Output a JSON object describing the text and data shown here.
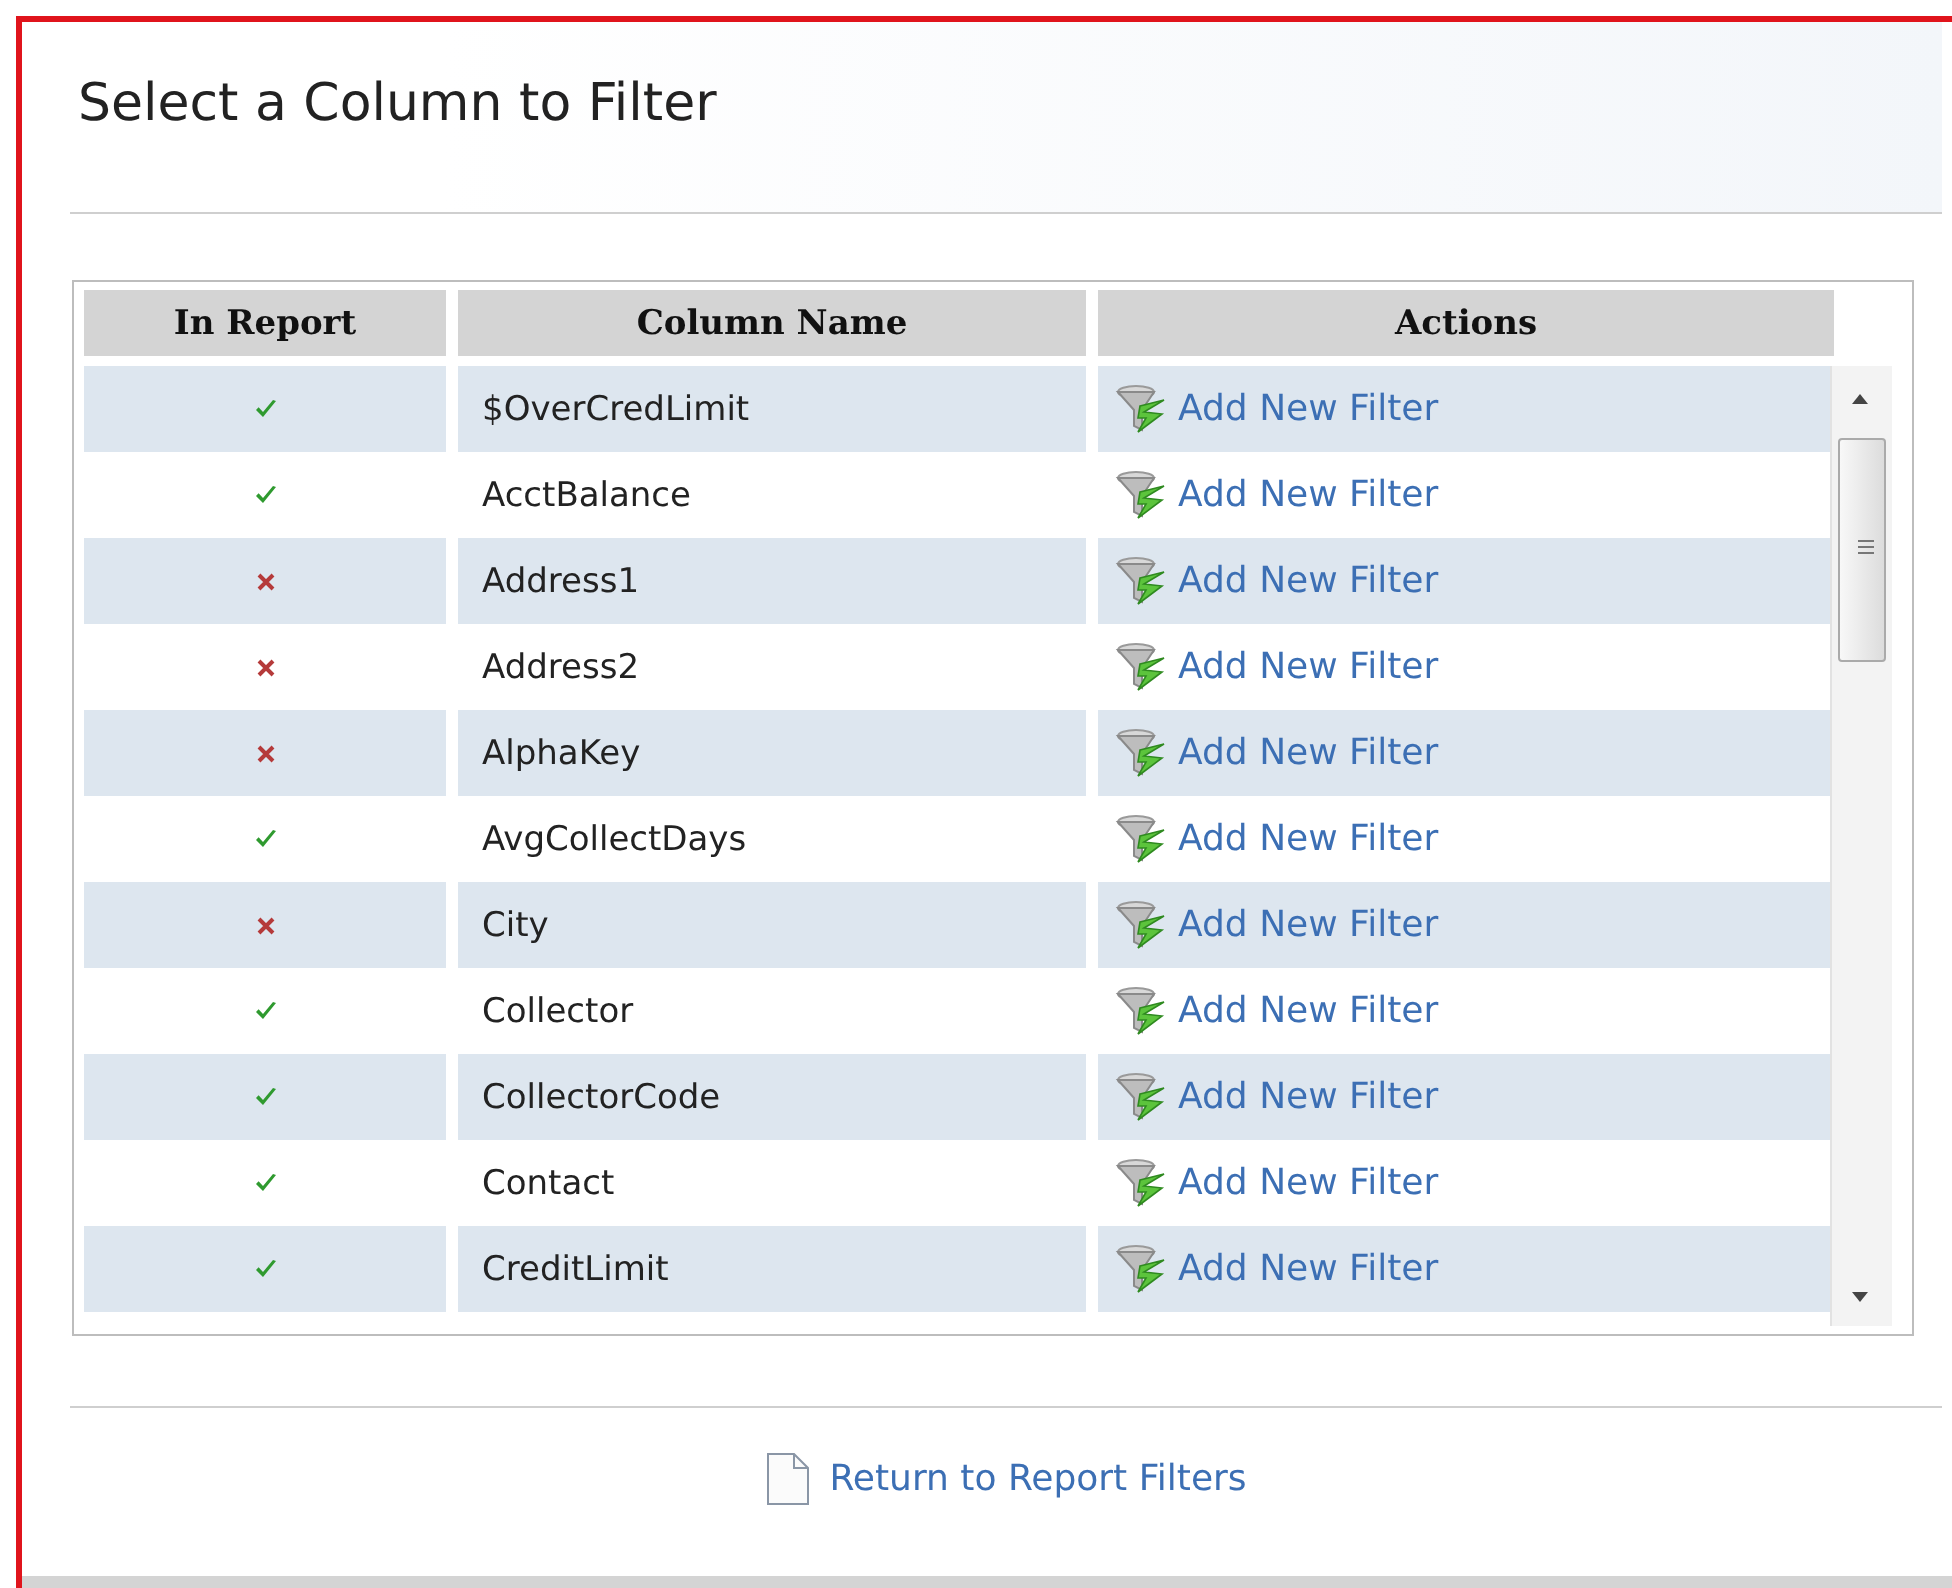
{
  "title": "Select a Column to Filter",
  "table": {
    "columns": [
      "In Report",
      "Column Name",
      "Actions"
    ],
    "rows": [
      {
        "in_report": true,
        "name": "$OverCredLimit",
        "action": "Add New Filter"
      },
      {
        "in_report": true,
        "name": "AcctBalance",
        "action": "Add New Filter"
      },
      {
        "in_report": false,
        "name": "Address1",
        "action": "Add New Filter"
      },
      {
        "in_report": false,
        "name": "Address2",
        "action": "Add New Filter"
      },
      {
        "in_report": false,
        "name": "AlphaKey",
        "action": "Add New Filter"
      },
      {
        "in_report": true,
        "name": "AvgCollectDays",
        "action": "Add New Filter"
      },
      {
        "in_report": false,
        "name": "City",
        "action": "Add New Filter"
      },
      {
        "in_report": true,
        "name": "Collector",
        "action": "Add New Filter"
      },
      {
        "in_report": true,
        "name": "CollectorCode",
        "action": "Add New Filter"
      },
      {
        "in_report": true,
        "name": "Contact",
        "action": "Add New Filter"
      },
      {
        "in_report": true,
        "name": "CreditLimit",
        "action": "Add New Filter"
      }
    ]
  },
  "return_link": "Return to Report Filters"
}
